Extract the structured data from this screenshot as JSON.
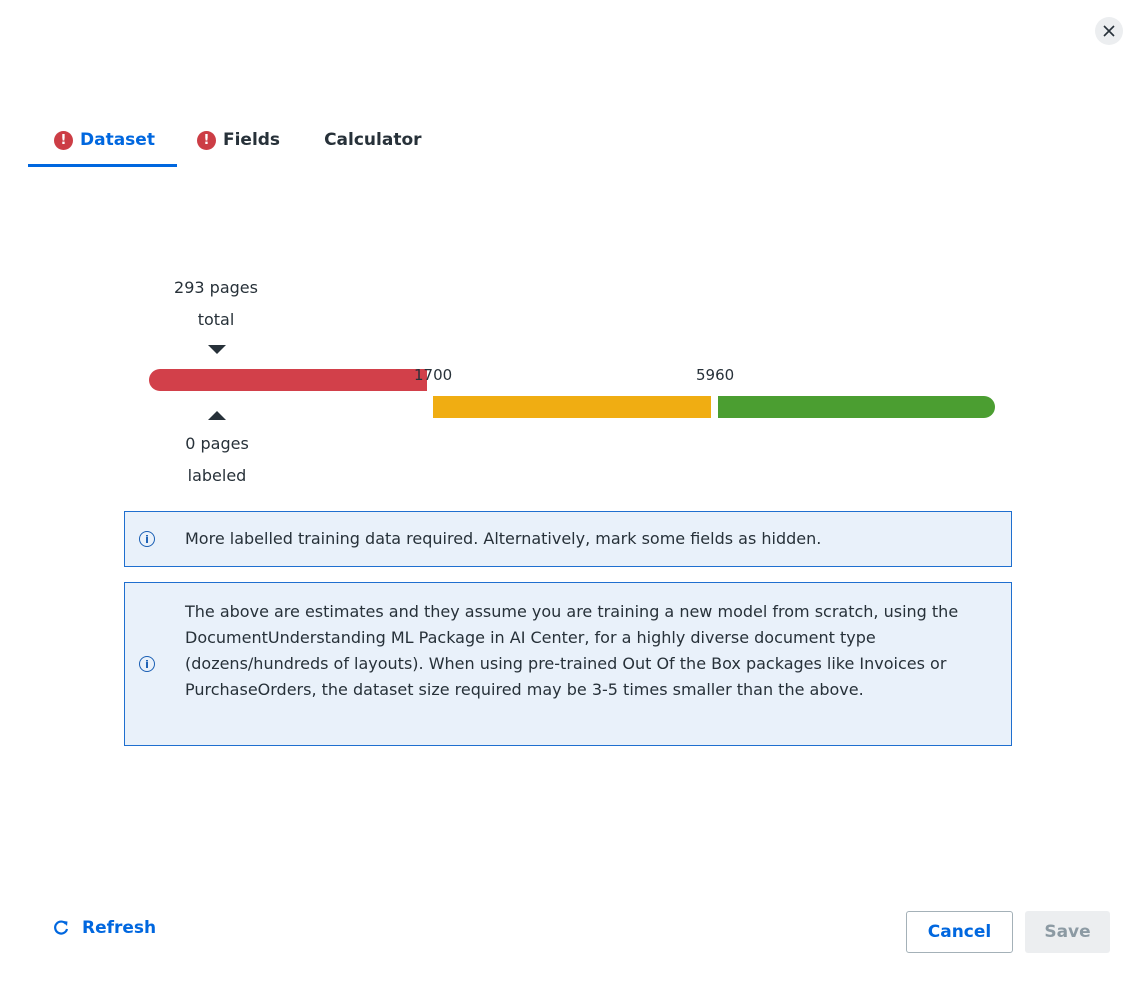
{
  "dialog": {
    "close_icon": "close-icon"
  },
  "tabs": [
    {
      "label": "Dataset",
      "active": true,
      "has_error": true
    },
    {
      "label": "Fields",
      "active": false,
      "has_error": true
    },
    {
      "label": "Calculator",
      "active": false,
      "has_error": false
    }
  ],
  "progress": {
    "total_label_line1": "293 pages",
    "total_label_line2": "total",
    "labeled_label_line1": "0 pages",
    "labeled_label_line2": "labeled",
    "threshold_1": "1700",
    "threshold_2": "5960",
    "colors": {
      "red": "#d2404a",
      "yellow": "#f0ad12",
      "green": "#4b9e31"
    }
  },
  "info_messages": [
    "More labelled training data required. Alternatively, mark some fields as hidden.",
    "The above are estimates and they assume you are training a new model from scratch, using the DocumentUnderstanding ML Package in AI Center, for a highly diverse document type (dozens/hundreds of layouts). When using pre-trained Out Of the Box packages like Invoices or PurchaseOrders, the dataset size required may be 3-5 times smaller than the above."
  ],
  "footer": {
    "refresh_label": "Refresh",
    "cancel_label": "Cancel",
    "save_label": "Save"
  },
  "colors": {
    "accent": "#0067df",
    "error": "#cc3d45",
    "info_bg": "#e9f1fa"
  }
}
